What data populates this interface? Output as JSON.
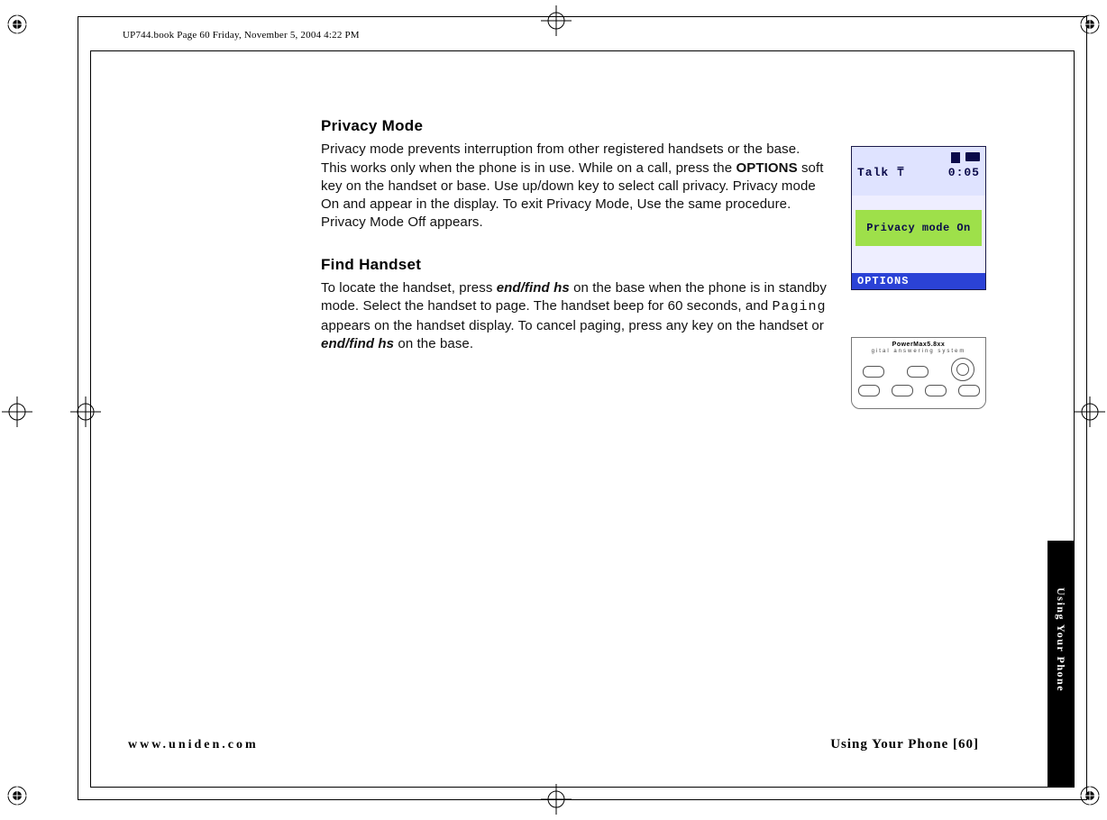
{
  "header": "UP744.book  Page 60  Friday, November 5, 2004  4:22 PM",
  "section1": {
    "title": "Privacy Mode",
    "body_parts": {
      "p1a": "Privacy mode prevents interruption from other registered handsets or the base. This works only when the phone is in use. While on a call, press the ",
      "options_label": "OPTIONS",
      "p1b": " soft key on the handset or base. Use up/down key to select call privacy. Privacy mode On and appear in the display. To exit Privacy Mode, Use the same procedure. Privacy Mode Off appears."
    }
  },
  "section2": {
    "title": "Find Handset",
    "body_parts": {
      "p2a": "To locate the handset, press ",
      "key1": "end/find hs",
      "p2b": " on the base when the phone is in standby mode. Select the handset to page. The handset beep for 60 seconds, and ",
      "paging": "Paging",
      "p2c": " appears on the handset display. To cancel paging, press any key on the handset or ",
      "key2": "end/find hs",
      "p2d": " on the base."
    }
  },
  "lcd": {
    "talk": "Talk",
    "antenna_glyph": "⍑",
    "time": "0:05",
    "message": "Privacy mode On",
    "softkey": "OPTIONS"
  },
  "base": {
    "brand": "PowerMax5.8xx",
    "subtitle": "gital  answering  system"
  },
  "footer": {
    "url": "www.uniden.com",
    "pageref": "Using Your Phone [60]"
  },
  "tab": "Using Your Phone"
}
